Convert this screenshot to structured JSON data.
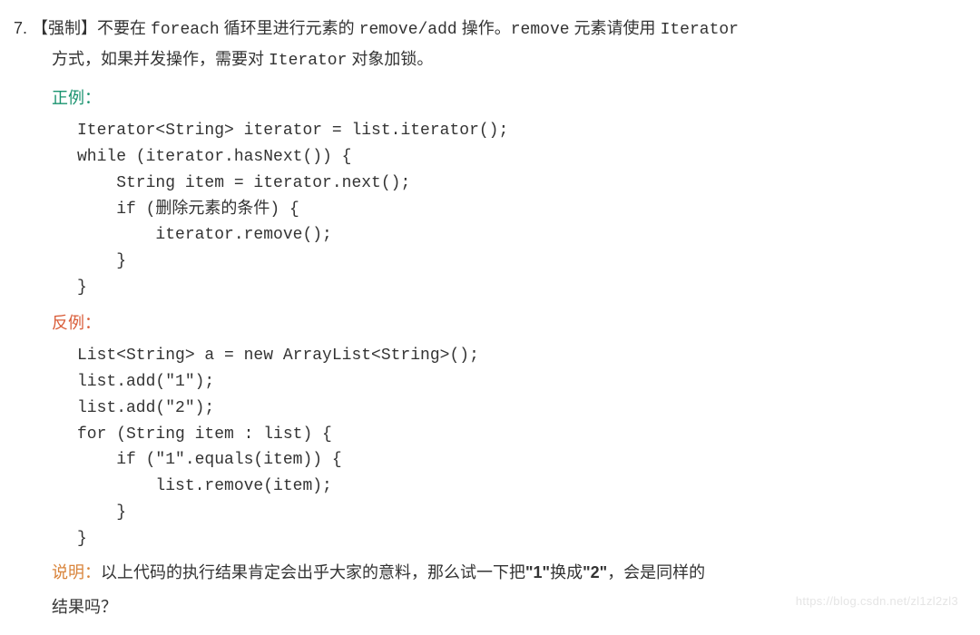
{
  "rule": {
    "number": "7.",
    "tag": "【强制】",
    "line1_prefix": "不要在 ",
    "mono1": "foreach",
    "line1_mid1": " 循环里进行元素的 ",
    "mono2": "remove/add",
    "line1_mid2": " 操作。",
    "mono3": "remove",
    "line1_mid3": " 元素请使用 ",
    "mono4": "Iterator",
    "line2_prefix": "方式，如果并发操作，需要对 ",
    "mono5": "Iterator",
    "line2_suffix": " 对象加锁。"
  },
  "labels": {
    "positive": "正例：",
    "negative": "反例：",
    "note": "说明："
  },
  "code": {
    "positive": "Iterator<String> iterator = list.iterator();\nwhile (iterator.hasNext()) {\n    String item = iterator.next();\n    if (删除元素的条件) {\n        iterator.remove();\n    }\n}",
    "negative": "List<String> a = new ArrayList<String>();\nlist.add(\"1\");\nlist.add(\"2\");\nfor (String item : list) {\n    if (\"1\".equals(item)) {\n        list.remove(item);\n    }\n}"
  },
  "note": {
    "part1": "以上代码的执行结果肯定会出乎大家的意料，那么试一下把",
    "bold1": "\"1\"",
    "part2": "换成",
    "bold2": "\"2\"",
    "part3": "，会是同样的",
    "part4": "结果吗？"
  },
  "watermark": "https://blog.csdn.net/zl1zl2zl3"
}
